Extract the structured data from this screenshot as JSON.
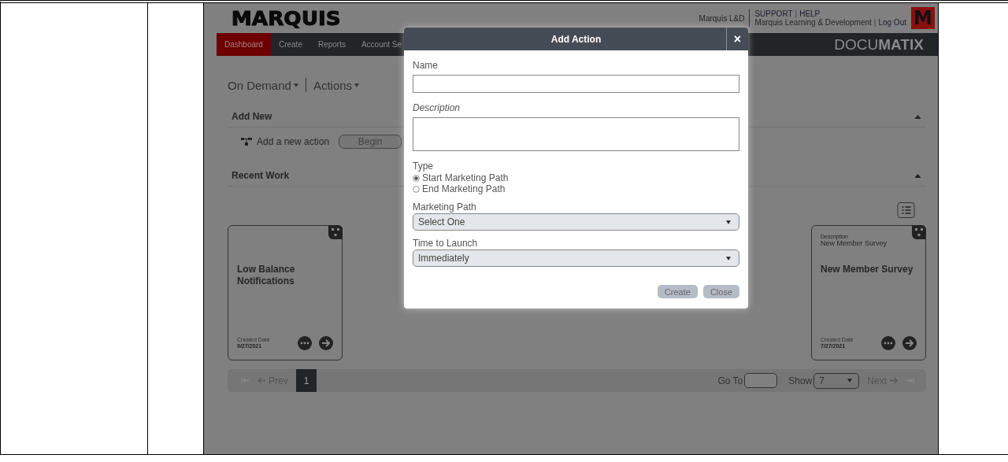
{
  "header": {
    "logo": "MARQUIS",
    "org": "Marquis L&D",
    "links": [
      {
        "kind": "link",
        "text": "SUPPORT"
      },
      {
        "kind": "sep",
        "text": "|"
      },
      {
        "kind": "link",
        "text": "HELP"
      }
    ],
    "account": [
      {
        "kind": "text",
        "text": "Marquis Learning & Development"
      },
      {
        "kind": "sep",
        "text": "|"
      },
      {
        "kind": "link",
        "text": "Log Out"
      }
    ],
    "logo_mark": "M"
  },
  "nav": {
    "tabs": [
      {
        "label": "Dashboard",
        "selected": true
      },
      {
        "label": "Create",
        "selected": false
      },
      {
        "label": "Reports",
        "selected": false
      },
      {
        "label": "Account Se",
        "selected": false
      }
    ],
    "brand": "DOCU**MATIX**"
  },
  "breadcrumb": [
    "On Demand",
    "Actions"
  ],
  "add_new": {
    "title": "Add New",
    "label": "Add a new action",
    "button": "Begin"
  },
  "recent_work": {
    "title": "Recent Work",
    "cards": [
      {
        "title": "Low Balance Notifications",
        "date_label": "Created Date",
        "date": "9/27/2021"
      },
      {
        "description_label": "Description",
        "description": "New Member Survey",
        "title": "New Member Survey",
        "date_label": "Created Date",
        "date": "7/27/2021"
      }
    ]
  },
  "pager": {
    "prev": "Prev",
    "pages": [
      {
        "label": "1",
        "selected": true
      }
    ],
    "goto": "Go To",
    "show": "Show",
    "show_value": "7",
    "next": "Next"
  },
  "dialog": {
    "title": "Add Action",
    "close": "×",
    "name_label": "Name",
    "description_label": "Description",
    "type_label": "Type",
    "types": [
      {
        "label": "Start Marketing Path",
        "selected": true
      },
      {
        "label": "End Marketing Path",
        "selected": false
      }
    ],
    "path_label": "Marketing Path",
    "path_value": "Select One",
    "launch_label": "Time to Launch",
    "launch_value": "Immediately",
    "buttons": [
      "Create",
      "Close"
    ]
  }
}
